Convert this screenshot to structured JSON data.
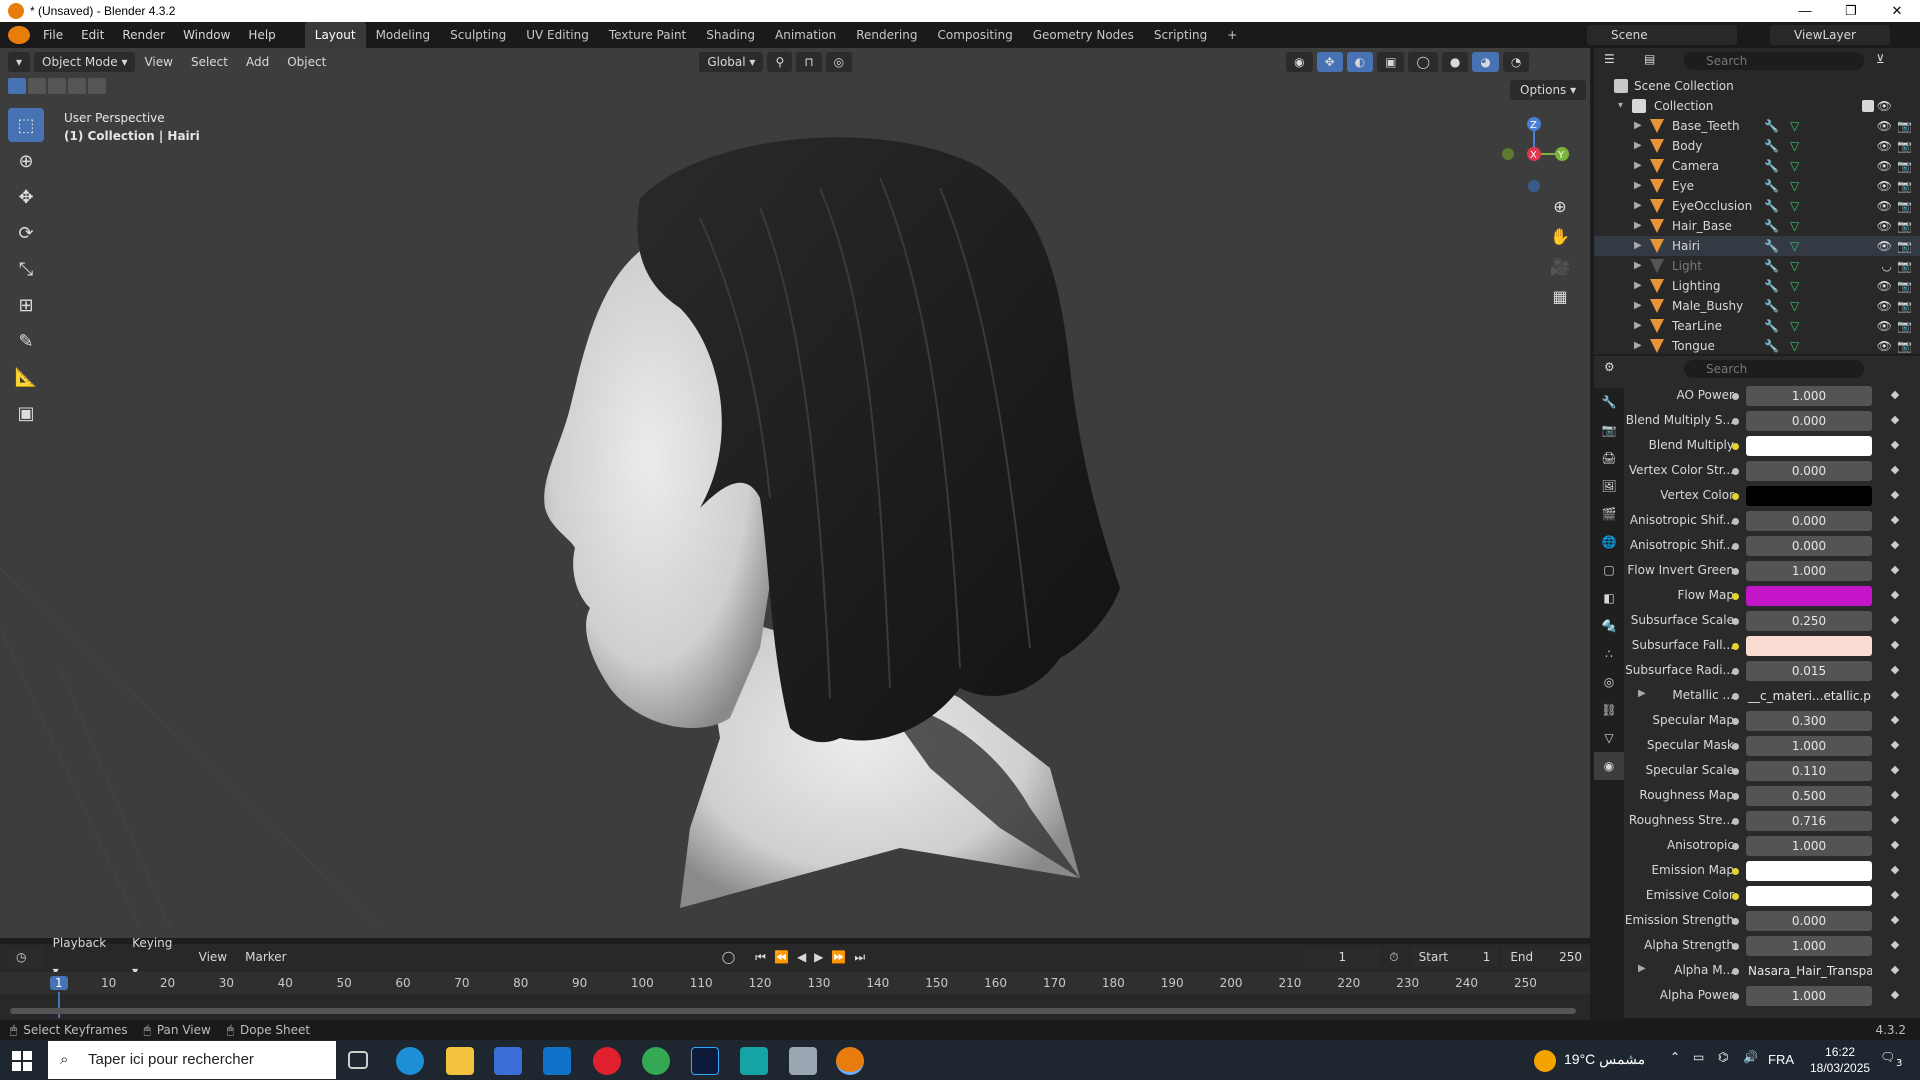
{
  "window": {
    "title": "* (Unsaved) - Blender 4.3.2",
    "controls": [
      "—",
      "❐",
      "✕"
    ]
  },
  "menu": [
    "File",
    "Edit",
    "Render",
    "Window",
    "Help"
  ],
  "workspaces": [
    "Layout",
    "Modeling",
    "Sculpting",
    "UV Editing",
    "Texture Paint",
    "Shading",
    "Animation",
    "Rendering",
    "Compositing",
    "Geometry Nodes",
    "Scripting",
    "+"
  ],
  "active_workspace": "Layout",
  "scene": "Scene",
  "view_layer": "ViewLayer",
  "viewport": {
    "mode": "Object Mode",
    "menus": [
      "View",
      "Select",
      "Add",
      "Object"
    ],
    "transform": "Global",
    "options": "Options",
    "info_line1": "User Perspective",
    "info_line2": "(1) Collection | Hairi",
    "gizmo": {
      "z": "Z",
      "x": "X",
      "y": "Y"
    }
  },
  "outliner": {
    "search_placeholder": "Search",
    "root": "Scene Collection",
    "collection": "Collection",
    "items": [
      {
        "name": "Base_Teeth",
        "type": "mesh",
        "visible": true
      },
      {
        "name": "Body",
        "type": "mesh",
        "visible": true
      },
      {
        "name": "Camera",
        "type": "camera",
        "visible": true
      },
      {
        "name": "Eye",
        "type": "mesh",
        "visible": true
      },
      {
        "name": "EyeOcclusion",
        "type": "mesh",
        "visible": true
      },
      {
        "name": "Hair_Base",
        "type": "mesh",
        "visible": true
      },
      {
        "name": "Hairi",
        "type": "mesh",
        "visible": true
      },
      {
        "name": "Light",
        "type": "light",
        "visible": false
      },
      {
        "name": "Lighting",
        "type": "armature",
        "visible": true
      },
      {
        "name": "Male_Bushy",
        "type": "mesh",
        "visible": true
      },
      {
        "name": "TearLine",
        "type": "mesh",
        "visible": true
      },
      {
        "name": "Tongue",
        "type": "mesh",
        "visible": true
      }
    ]
  },
  "properties": {
    "search_placeholder": "Search",
    "rows": [
      {
        "label": "AO Power",
        "value": "1.000",
        "kind": "num"
      },
      {
        "label": "Blend Multiply S...",
        "value": "0.000",
        "kind": "num"
      },
      {
        "label": "Blend Multiply",
        "value": "",
        "kind": "color",
        "color": "#ffffff"
      },
      {
        "label": "Vertex Color Str...",
        "value": "0.000",
        "kind": "num"
      },
      {
        "label": "Vertex Color",
        "value": "",
        "kind": "color",
        "color": "#000000"
      },
      {
        "label": "Anisotropic Shif...",
        "value": "0.000",
        "kind": "num"
      },
      {
        "label": "Anisotropic Shif...",
        "value": "0.000",
        "kind": "num"
      },
      {
        "label": "Flow Invert Green",
        "value": "1.000",
        "kind": "num"
      },
      {
        "label": "Flow Map",
        "value": "",
        "kind": "color",
        "color": "#c315c7"
      },
      {
        "label": "Subsurface Scale",
        "value": "0.250",
        "kind": "num"
      },
      {
        "label": "Subsurface Fall...",
        "value": "",
        "kind": "color",
        "color": "#fbdcd2"
      },
      {
        "label": "Subsurface Radi...",
        "value": "0.015",
        "kind": "num"
      },
      {
        "label": "Metallic ...",
        "value": "__c_materi...etallic.png",
        "kind": "file"
      },
      {
        "label": "Specular Map",
        "value": "0.300",
        "kind": "num"
      },
      {
        "label": "Specular Mask",
        "value": "1.000",
        "kind": "num"
      },
      {
        "label": "Specular Scale",
        "value": "0.110",
        "kind": "num"
      },
      {
        "label": "Roughness Map",
        "value": "0.500",
        "kind": "num"
      },
      {
        "label": "Roughness Stre...",
        "value": "0.716",
        "kind": "num"
      },
      {
        "label": "Anisotropic",
        "value": "1.000",
        "kind": "num"
      },
      {
        "label": "Emission Map",
        "value": "",
        "kind": "color",
        "color": "#ffffff"
      },
      {
        "label": "Emissive Color",
        "value": "",
        "kind": "color",
        "color": "#ffffff"
      },
      {
        "label": "Emission Strength",
        "value": "0.000",
        "kind": "num"
      },
      {
        "label": "Alpha Strength",
        "value": "1.000",
        "kind": "num"
      },
      {
        "label": "Alpha M...",
        "value": "Nasara_Hair_Transpar...",
        "kind": "file"
      },
      {
        "label": "Alpha Power",
        "value": "1.000",
        "kind": "num"
      }
    ]
  },
  "timeline": {
    "menus": [
      "Playback",
      "Keying",
      "View",
      "Marker"
    ],
    "current_frame": "1",
    "start_label": "Start",
    "start": "1",
    "end_label": "End",
    "end": "250",
    "ticks": [
      "1",
      "10",
      "20",
      "30",
      "40",
      "50",
      "60",
      "70",
      "80",
      "90",
      "100",
      "110",
      "120",
      "130",
      "140",
      "150",
      "160",
      "170",
      "180",
      "190",
      "200",
      "210",
      "220",
      "230",
      "240",
      "250"
    ]
  },
  "statusbar": {
    "hint1": "Select Keyframes",
    "hint2": "Pan View",
    "hint3": "Dope Sheet",
    "version": "4.3.2"
  },
  "taskbar": {
    "search_placeholder": "Taper ici pour rechercher",
    "weather": "19°C  مشمس",
    "language": "FRA",
    "time": "16:22",
    "date": "18/03/2025",
    "notification_count": "3"
  },
  "colors": {
    "accent": "#4772b3",
    "object_orange": "#e8953a",
    "blender_orange": "#e87d0d"
  }
}
